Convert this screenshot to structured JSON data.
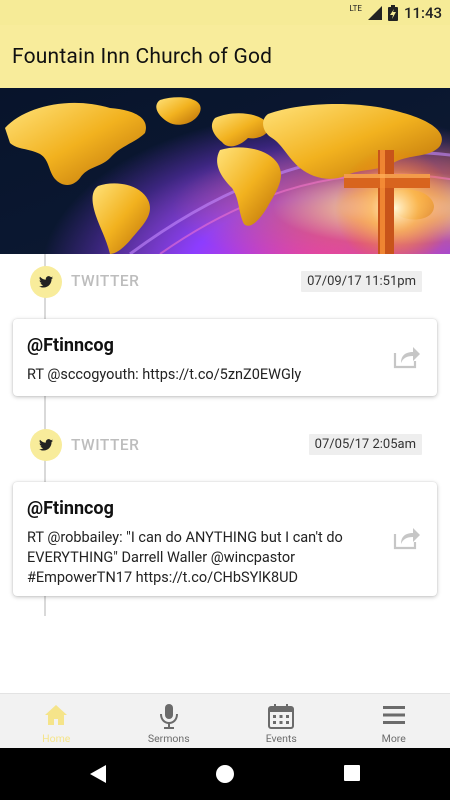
{
  "status_bar": {
    "network": "LTE",
    "time": "11:43"
  },
  "app_bar": {
    "title": "Fountain Inn Church of God"
  },
  "feed": [
    {
      "source": "TWITTER",
      "date": "07/09/17 11:51pm",
      "handle": "@Ftinncog",
      "text": "RT @sccogyouth: https://t.co/5znZ0EWGly"
    },
    {
      "source": "TWITTER",
      "date": "07/05/17 2:05am",
      "handle": "@Ftinncog",
      "text": "RT @robbailey: \"I can do ANYTHING but I can't do EVERYTHING\" Darrell Waller @wincpastor #EmpowerTN17 https://t.co/CHbSYlK8UD"
    }
  ],
  "bottom_nav": {
    "items": [
      {
        "label": "Home",
        "icon": "home-icon",
        "active": true
      },
      {
        "label": "Sermons",
        "icon": "microphone-icon",
        "active": false
      },
      {
        "label": "Events",
        "icon": "calendar-icon",
        "active": false
      },
      {
        "label": "More",
        "icon": "menu-icon",
        "active": false
      }
    ]
  },
  "colors": {
    "accent": "#f8ec9b",
    "active_nav": "#f5e48a",
    "muted_label": "#bdbdbd"
  }
}
